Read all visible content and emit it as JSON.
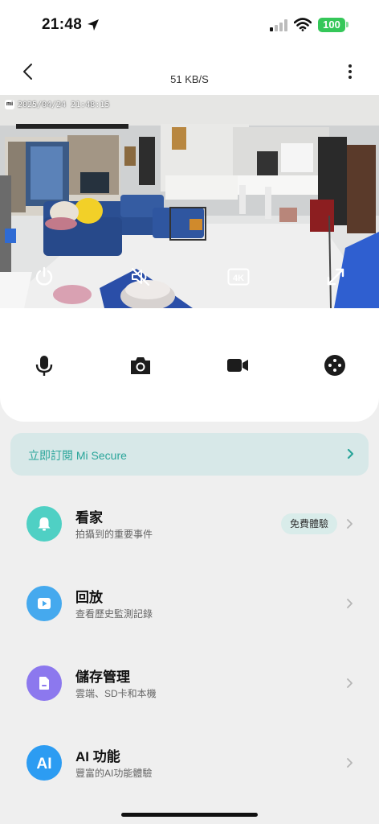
{
  "status_bar": {
    "time": "21:48",
    "battery": "100"
  },
  "header": {
    "title": "51 KB/S"
  },
  "video": {
    "timestamp": "2025/04/24 21:48:15",
    "logo_text": "mi",
    "quality_label": "4K"
  },
  "toolbar": {
    "icons": [
      "microphone-icon",
      "camera-icon",
      "video-record-icon",
      "more-dots-icon"
    ]
  },
  "promo": {
    "label": "立即訂閱 Mi Secure"
  },
  "menu": {
    "items": [
      {
        "title": "看家",
        "subtitle": "拍攝到的重要事件",
        "badge": "免費體驗",
        "icon": "bell-icon",
        "color": "#4fd0c4"
      },
      {
        "title": "回放",
        "subtitle": "查看歷史監測記錄",
        "icon": "play-icon",
        "color": "#45a9ee"
      },
      {
        "title": "儲存管理",
        "subtitle": "雲端、SD卡和本機",
        "icon": "storage-icon",
        "color": "#8c78ee"
      },
      {
        "title": "AI 功能",
        "subtitle": "豐富的AI功能體驗",
        "icon": "ai-icon",
        "icon_text": "AI",
        "color": "#2c9cf2"
      }
    ]
  },
  "colors": {
    "accent": "#2aa59a",
    "battery": "#35c759"
  }
}
